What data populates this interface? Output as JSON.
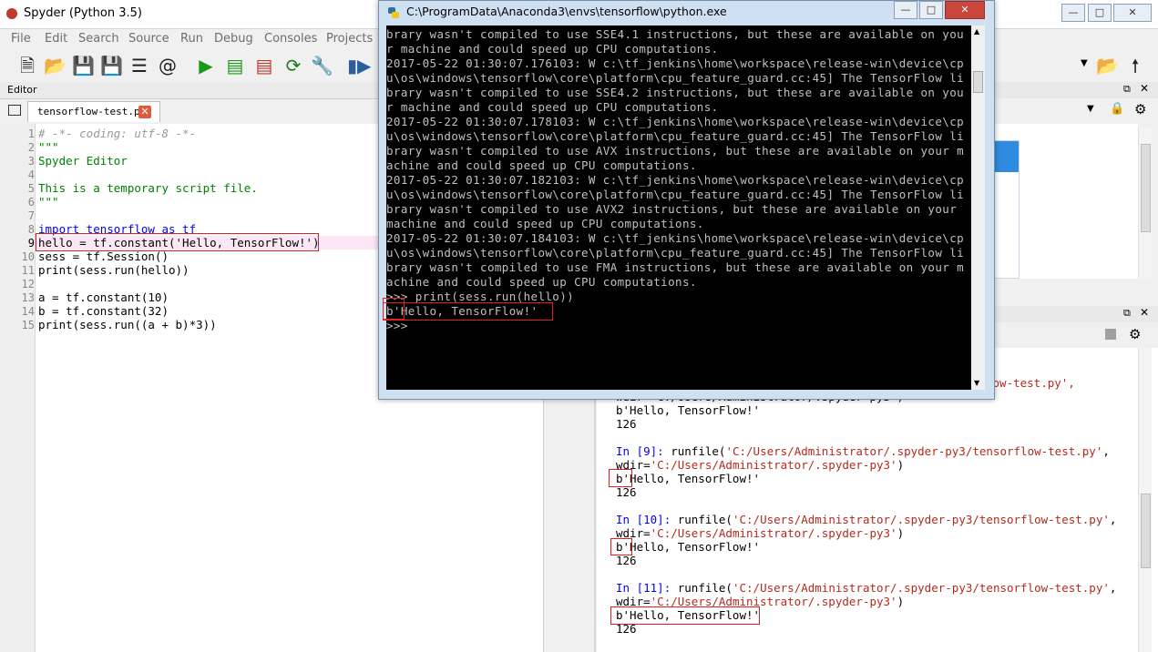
{
  "app": {
    "title": "Spyder (Python 3.5)"
  },
  "menu": [
    "File",
    "Edit",
    "Search",
    "Source",
    "Run",
    "Debug",
    "Consoles",
    "Projects"
  ],
  "editor": {
    "pane_label": "Editor",
    "tab_label": "tensorflow-test.py",
    "line_numbers": [
      "1",
      "2",
      "3",
      "4",
      "5",
      "6",
      "7",
      "8",
      "9",
      "10",
      "11",
      "12",
      "13",
      "14",
      "15"
    ],
    "lines": [
      "# -*- coding: utf-8 -*-",
      "\"\"\"",
      "Spyder Editor",
      "",
      "This is a temporary script file.",
      "\"\"\"",
      "",
      "import tensorflow as tf",
      "hello = tf.constant('Hello, TensorFlow!')",
      "sess = tf.Session()",
      "print(sess.run(hello))",
      "",
      "a = tf.constant(10)",
      "b = tf.constant(32)",
      "print(sess.run((a + b)*3))"
    ]
  },
  "cmd": {
    "title": "C:\\ProgramData\\Anaconda3\\envs\\tensorflow\\python.exe",
    "lines": [
      "brary wasn't compiled to use SSE4.1 instructions, but these are available on you",
      "r machine and could speed up CPU computations.",
      "2017-05-22 01:30:07.176103: W c:\\tf_jenkins\\home\\workspace\\release-win\\device\\cp",
      "u\\os\\windows\\tensorflow\\core\\platform\\cpu_feature_guard.cc:45] The TensorFlow li",
      "brary wasn't compiled to use SSE4.2 instructions, but these are available on you",
      "r machine and could speed up CPU computations.",
      "2017-05-22 01:30:07.178103: W c:\\tf_jenkins\\home\\workspace\\release-win\\device\\cp",
      "u\\os\\windows\\tensorflow\\core\\platform\\cpu_feature_guard.cc:45] The TensorFlow li",
      "brary wasn't compiled to use AVX instructions, but these are available on your m",
      "achine and could speed up CPU computations.",
      "2017-05-22 01:30:07.182103: W c:\\tf_jenkins\\home\\workspace\\release-win\\device\\cp",
      "u\\os\\windows\\tensorflow\\core\\platform\\cpu_feature_guard.cc:45] The TensorFlow li",
      "brary wasn't compiled to use AVX2 instructions, but these are available on your",
      "machine and could speed up CPU computations.",
      "2017-05-22 01:30:07.184103: W c:\\tf_jenkins\\home\\workspace\\release-win\\device\\cp",
      "u\\os\\windows\\tensorflow\\core\\platform\\cpu_feature_guard.cc:45] The TensorFlow li",
      "brary wasn't compiled to use FMA instructions, but these are available on your m",
      "achine and could speed up CPU computations.",
      ">>> print(sess.run(hello))",
      "b'Hello, TensorFlow!'",
      ">>>"
    ]
  },
  "console": {
    "partial_top": "low-test.py',",
    "partial_wdir": "wdir='C:/Users/Administrator/.spyder-py3')",
    "out_hello": "b'Hello, TensorFlow!'",
    "out_num": "126",
    "entries": [
      {
        "prompt": "In [",
        "num": "9",
        "close": "]: ",
        "call": "runfile(",
        "path": "'C:/Users/Administrator/.spyder-py3/tensorflow-test.py'",
        "tail": ",",
        "wdir_key": "wdir=",
        "wdir_val": "'C:/Users/Administrator/.spyder-py3'",
        "wdir_end": ")",
        "output": "b'Hello, TensorFlow!'",
        "result": "126"
      },
      {
        "prompt": "In [",
        "num": "10",
        "close": "]: ",
        "call": "runfile(",
        "path": "'C:/Users/Administrator/.spyder-py3/tensorflow-test.py'",
        "tail": ",",
        "wdir_key": "wdir=",
        "wdir_val": "'C:/Users/Administrator/.spyder-py3'",
        "wdir_end": ")",
        "output": "b'Hello, TensorFlow!'",
        "result": "126"
      },
      {
        "prompt": "In [",
        "num": "11",
        "close": "]: ",
        "call": "runfile(",
        "path": "'C:/Users/Administrator/.spyder-py3/tensorflow-test.py'",
        "tail": ",",
        "wdir_key": "wdir=",
        "wdir_val": "'C:/Users/Administrator/.spyder-py3'",
        "wdir_end": ")",
        "output": "b'Hello, TensorFlow!'",
        "result": "126"
      }
    ]
  },
  "colors": {
    "highlight_box": "#e02020",
    "cmd_bg": "#000000",
    "cmd_text": "#c0c0c0"
  }
}
